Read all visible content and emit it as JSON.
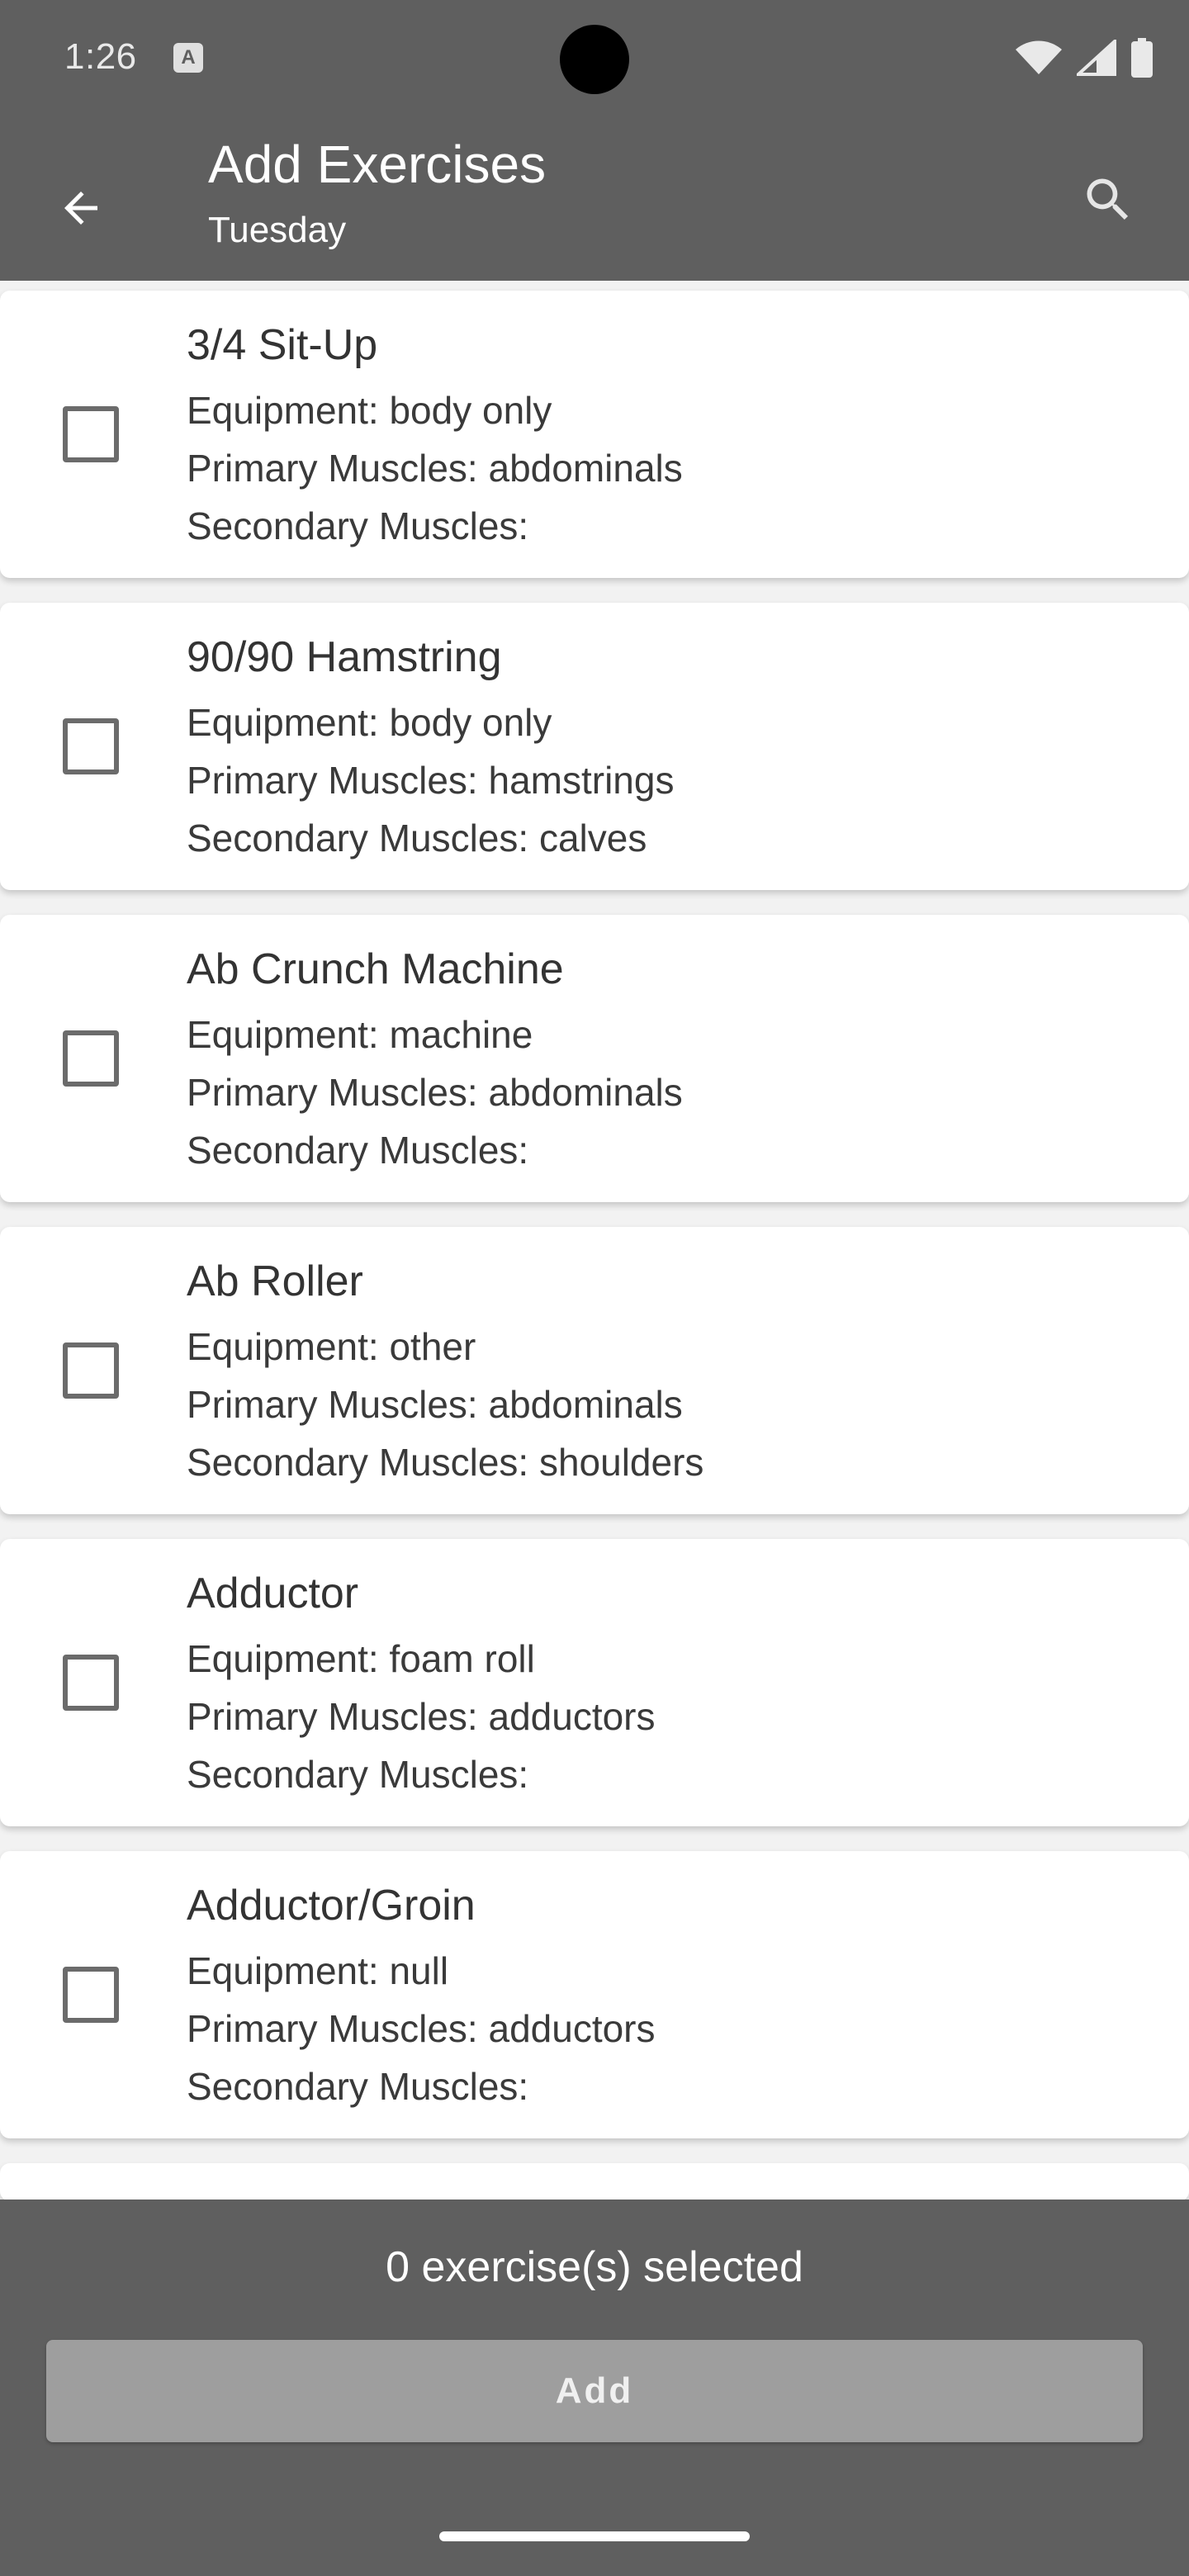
{
  "status_bar": {
    "time": "1:26",
    "notification_icon_letter": "A",
    "icons": [
      "wifi-icon",
      "signal-icon",
      "battery-icon"
    ]
  },
  "app_bar": {
    "title": "Add Exercises",
    "subtitle": "Tuesday",
    "back_icon": "back-arrow-icon",
    "search_icon": "search-icon"
  },
  "exercises": [
    {
      "name": "3/4 Sit-Up",
      "equipment": "Equipment: body only",
      "primary": "Primary Muscles: abdominals",
      "secondary": "Secondary Muscles:"
    },
    {
      "name": "90/90 Hamstring",
      "equipment": "Equipment: body only",
      "primary": "Primary Muscles: hamstrings",
      "secondary": "Secondary Muscles: calves"
    },
    {
      "name": "Ab Crunch Machine",
      "equipment": "Equipment: machine",
      "primary": "Primary Muscles: abdominals",
      "secondary": "Secondary Muscles:"
    },
    {
      "name": "Ab Roller",
      "equipment": "Equipment: other",
      "primary": "Primary Muscles: abdominals",
      "secondary": "Secondary Muscles: shoulders"
    },
    {
      "name": "Adductor",
      "equipment": "Equipment: foam roll",
      "primary": "Primary Muscles: adductors",
      "secondary": "Secondary Muscles:"
    },
    {
      "name": "Adductor/Groin",
      "equipment": "Equipment: null",
      "primary": "Primary Muscles: adductors",
      "secondary": "Secondary Muscles:"
    }
  ],
  "bottom": {
    "selected_text": "0 exercise(s) selected",
    "add_label": "Add"
  },
  "colors": {
    "app_bar_bg": "#5f5f5f",
    "card_bg": "#ffffff",
    "button_disabled": "#9e9e9e"
  }
}
